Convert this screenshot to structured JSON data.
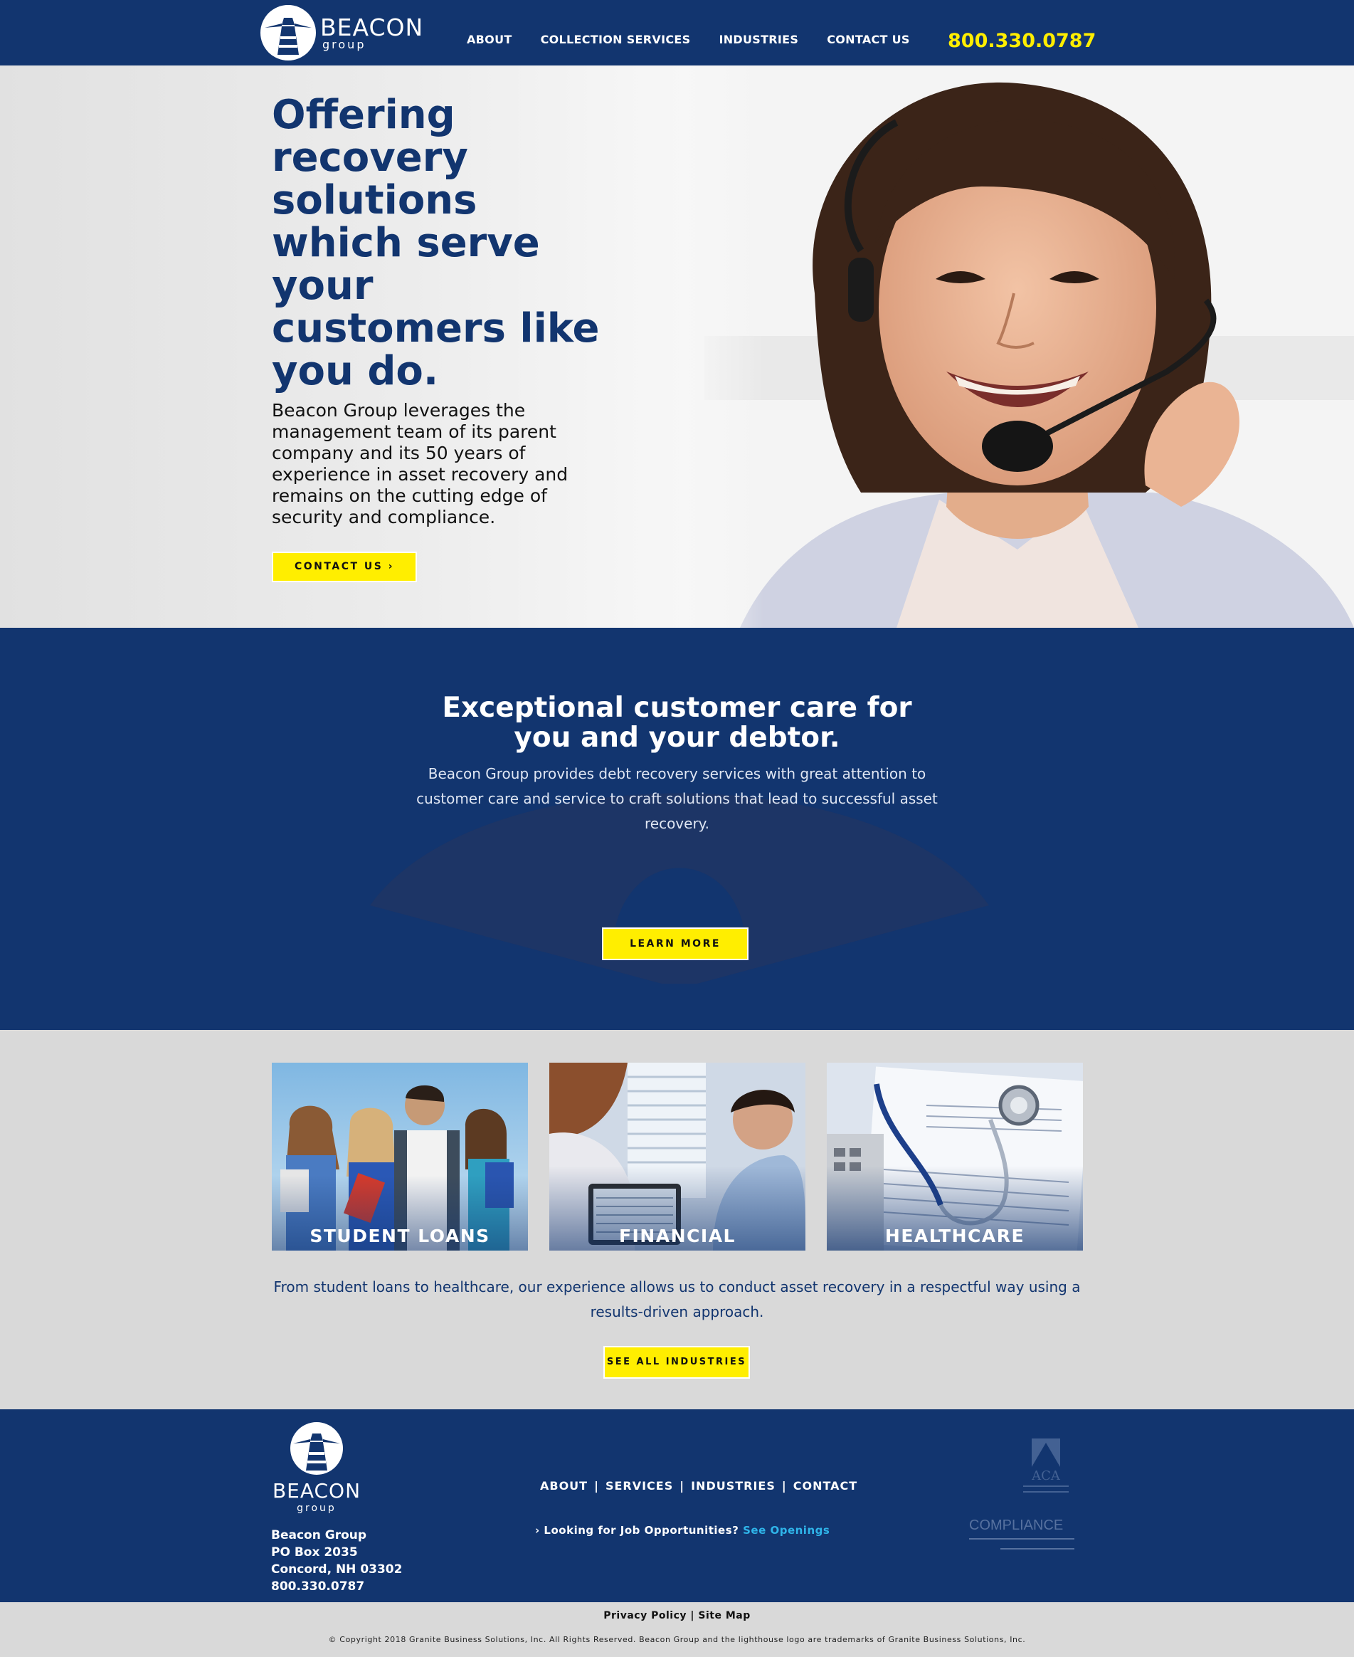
{
  "brand": {
    "name": "BEACON",
    "sub": "group"
  },
  "nav": {
    "items": [
      "ABOUT",
      "COLLECTION SERVICES",
      "INDUSTRIES",
      "CONTACT US"
    ],
    "phone": "800.330.0787"
  },
  "hero": {
    "title": "Offering recovery solutions which serve your customers like you do.",
    "body": "Beacon Group leverages the management team of its parent company and its 50 years of experience in asset recovery and remains on the cutting edge of security and compliance.",
    "button": "CONTACT US ›"
  },
  "care": {
    "title": "Exceptional customer care for you and your debtor.",
    "body": "Beacon Group provides debt recovery services with great attention to customer care and service to craft solutions that lead to successful asset recovery.",
    "button": "LEARN MORE"
  },
  "industries": {
    "cards": [
      "STUDENT LOANS",
      "FINANCIAL",
      "HEALTHCARE"
    ],
    "text": "From student loans to healthcare, our experience allows us to conduct asset recovery in a respectful way using a results-driven approach.",
    "button": "SEE ALL INDUSTRIES"
  },
  "footer": {
    "address": [
      "Beacon Group",
      "PO Box 2035",
      "Concord, NH 03302",
      "800.330.0787"
    ],
    "links": [
      "ABOUT",
      "SERVICES",
      "INDUSTRIES",
      "CONTACT"
    ],
    "jobs_text": "Looking for Job Opportunities?",
    "jobs_link": "See Openings",
    "badge_aca": "ACA",
    "badge_cpf": "COMPLIANCE"
  },
  "bottom": {
    "privacy": "Privacy Policy",
    "sitemap": "Site Map",
    "copyright": "© Copyright 2018 Granite Business Solutions, Inc. All Rights Reserved. Beacon Group and the lighthouse logo are trademarks of Granite Business Solutions, Inc."
  },
  "colors": {
    "navy": "#12356f",
    "yellow": "#ffee00",
    "link": "#2fb5ea"
  }
}
